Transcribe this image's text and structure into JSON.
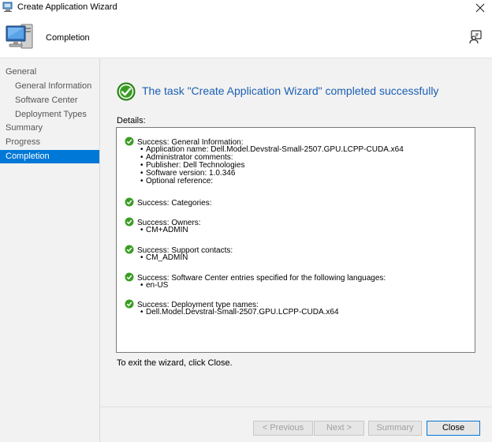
{
  "window": {
    "title": "Create Application Wizard"
  },
  "header": {
    "page_heading": "Completion"
  },
  "sidebar": {
    "items": [
      {
        "label": "General",
        "level": 1,
        "selected": false
      },
      {
        "label": "General Information",
        "level": 2,
        "selected": false
      },
      {
        "label": "Software Center",
        "level": 2,
        "selected": false
      },
      {
        "label": "Deployment Types",
        "level": 2,
        "selected": false
      },
      {
        "label": "Summary",
        "level": 1,
        "selected": false
      },
      {
        "label": "Progress",
        "level": 1,
        "selected": false
      },
      {
        "label": "Completion",
        "level": 1,
        "selected": true
      }
    ]
  },
  "main": {
    "headline": "The task \"Create Application Wizard\" completed successfully",
    "details_label": "Details:",
    "entries": [
      {
        "heading": "Success: General Information:",
        "bullets": [
          "Application name: Dell.Model.Devstral-Small-2507.GPU.LCPP-CUDA.x64",
          "Administrator comments:",
          "Publisher: Dell Technologies",
          "Software version: 1.0.346",
          "Optional reference:"
        ]
      },
      {
        "heading": "Success: Categories:",
        "bullets": []
      },
      {
        "heading": "Success: Owners:",
        "bullets": [
          "CM+ADMIN"
        ]
      },
      {
        "heading": "Success: Support contacts:",
        "bullets": [
          "CM_ADMIN"
        ]
      },
      {
        "heading": "Success: Software Center entries specified for the following languages:",
        "bullets": [
          "en-US"
        ]
      },
      {
        "heading": "Success: Deployment type names:",
        "bullets": [
          "Dell.Model.Devstral-Small-2507.GPU.LCPP-CUDA.x64"
        ]
      }
    ],
    "exit_text": "To exit the wizard, click Close."
  },
  "footer": {
    "previous_label": "< Previous",
    "next_label": "Next >",
    "summary_label": "Summary",
    "close_label": "Close"
  },
  "colors": {
    "accent": "#0078d7",
    "headline": "#1a5fb4",
    "success": "#3a9d23"
  }
}
